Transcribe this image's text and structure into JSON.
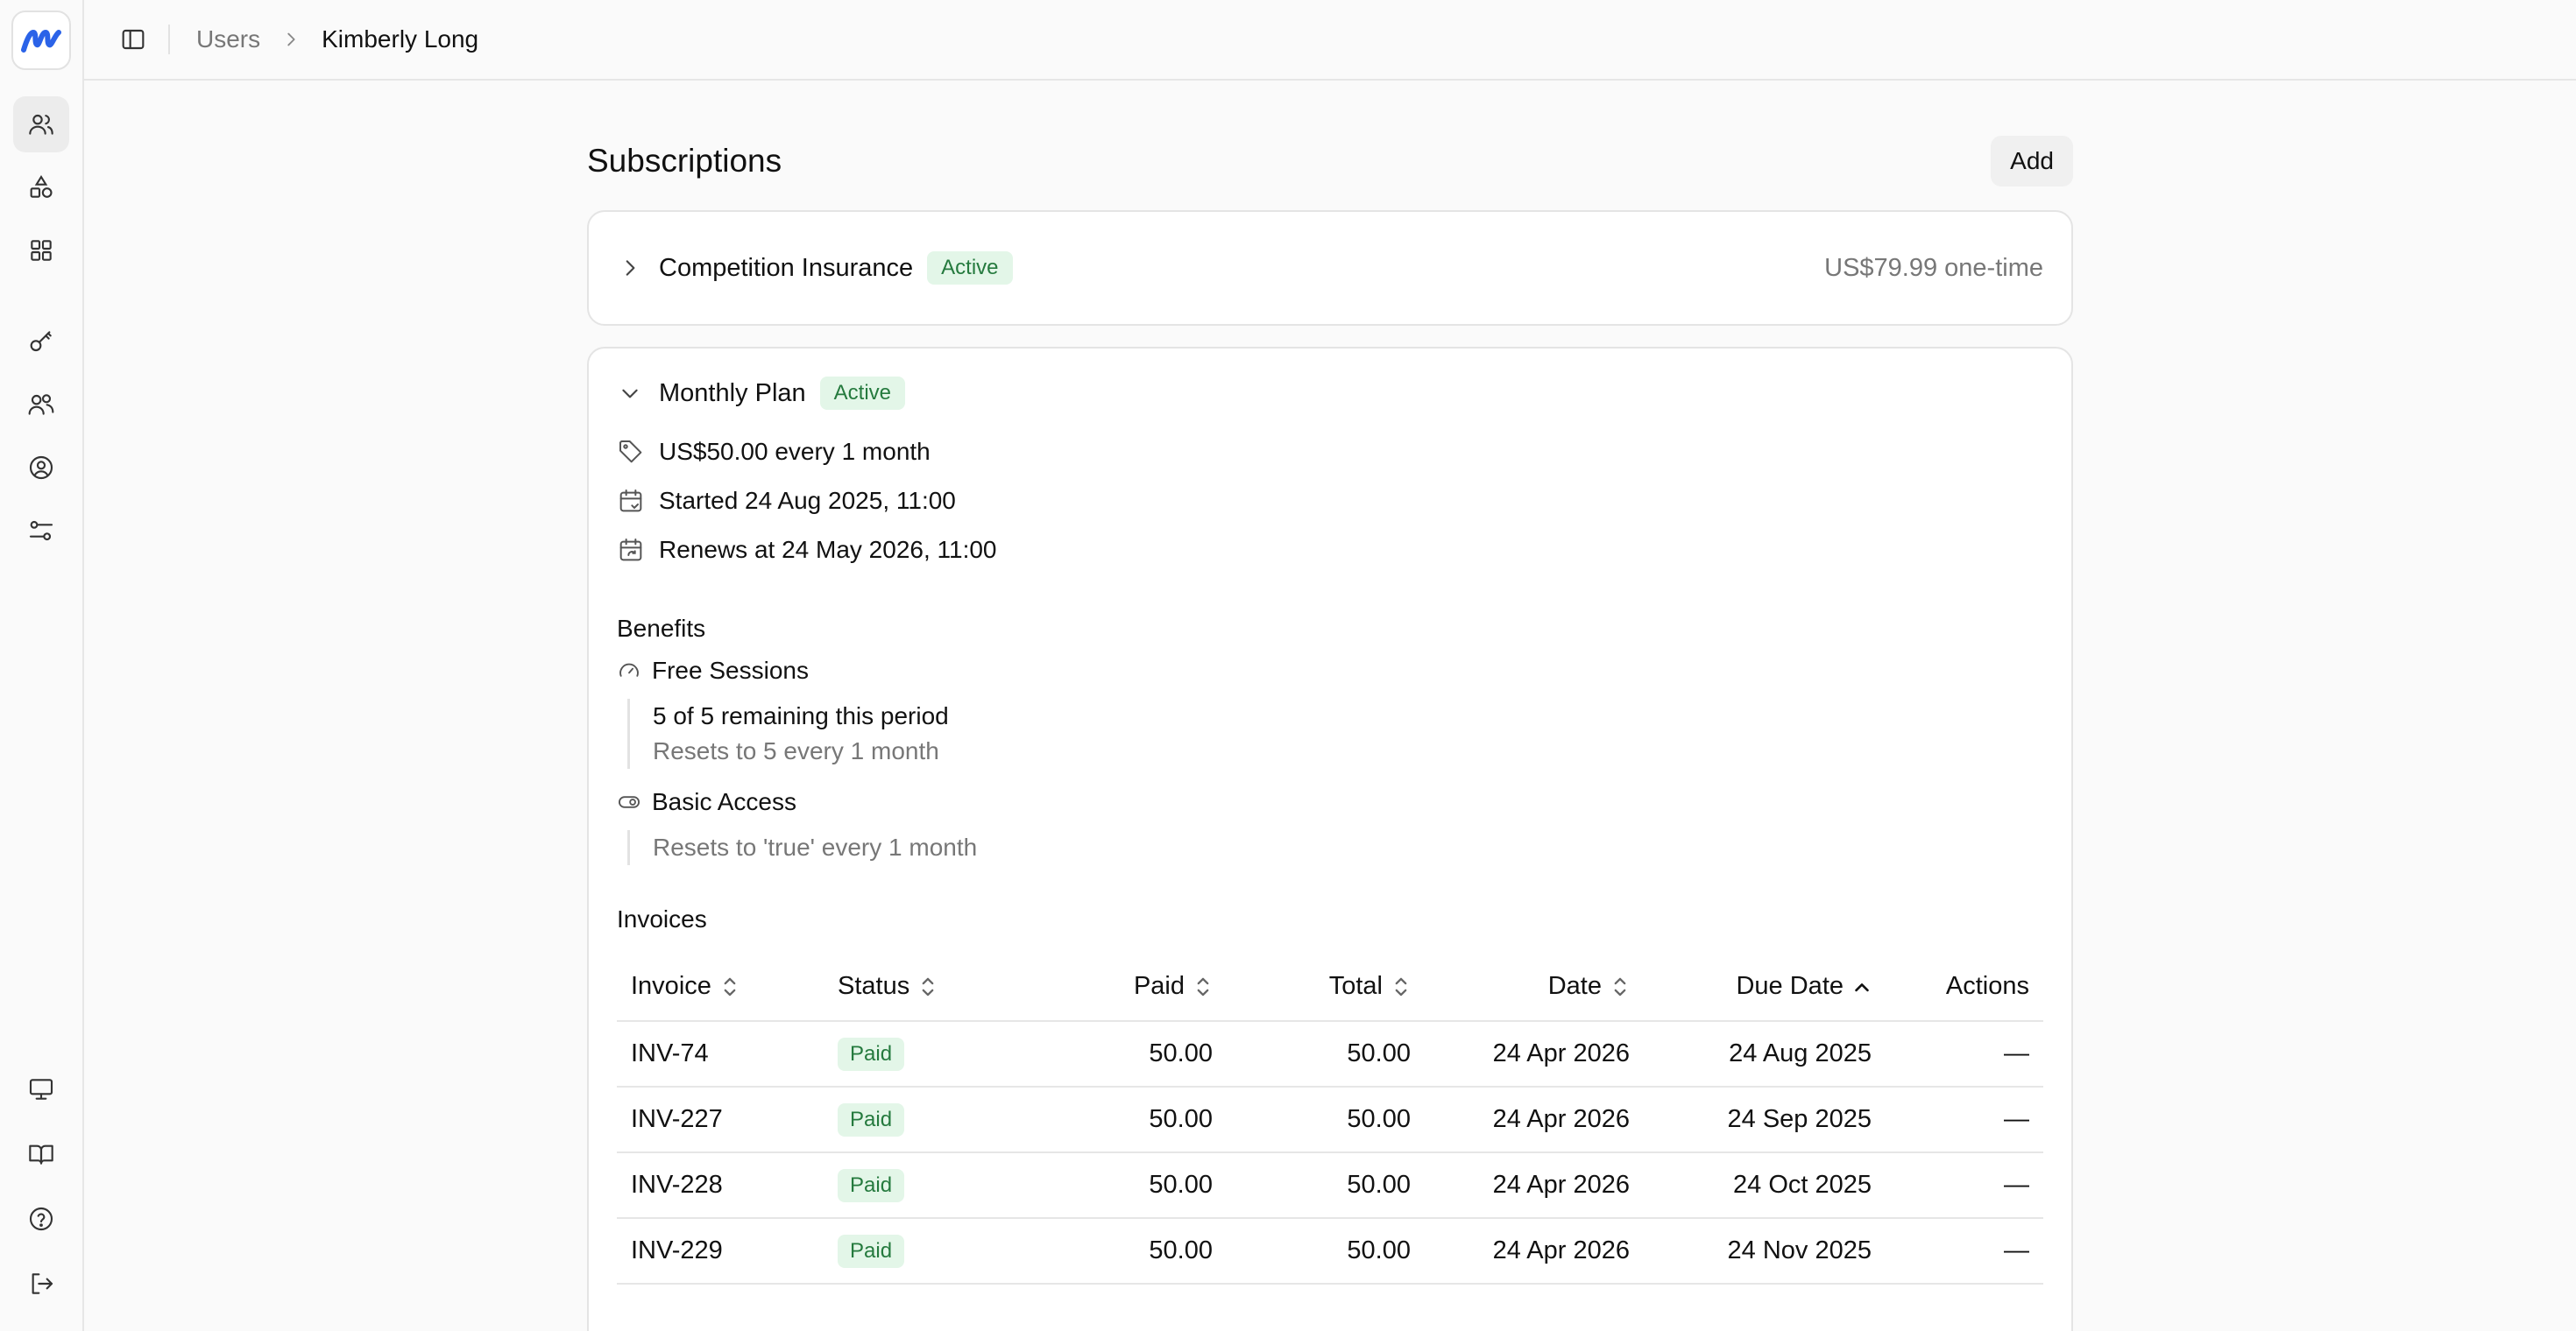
{
  "breadcrumb": {
    "parent": "Users",
    "current": "Kimberly Long"
  },
  "sidebar": {
    "top_items": [
      {
        "icon": "users-icon",
        "active": true
      },
      {
        "icon": "shapes-icon",
        "active": false
      },
      {
        "icon": "grid-icon",
        "active": false
      }
    ],
    "mid_items": [
      {
        "icon": "key-icon"
      },
      {
        "icon": "customers-icon"
      },
      {
        "icon": "user-circle-icon"
      },
      {
        "icon": "settings-sliders-icon"
      }
    ],
    "bottom_items": [
      {
        "icon": "monitor-icon"
      },
      {
        "icon": "book-icon"
      },
      {
        "icon": "help-icon"
      },
      {
        "icon": "logout-icon"
      }
    ]
  },
  "subscriptions": {
    "title": "Subscriptions",
    "add_label": "Add",
    "items": [
      {
        "name": "Competition Insurance",
        "status": "Active",
        "price": "US$79.99 one-time"
      },
      {
        "name": "Monthly Plan",
        "status": "Active",
        "price_line": "US$50.00 every 1 month",
        "started": "Started 24 Aug 2025, 11:00",
        "renews": "Renews at 24 May 2026, 11:00"
      }
    ]
  },
  "benefits": {
    "label": "Benefits",
    "items": [
      {
        "name": "Free Sessions",
        "lines": [
          "5 of 5 remaining this period",
          "Resets to 5 every 1 month"
        ]
      },
      {
        "name": "Basic Access",
        "lines": [
          "Resets to 'true' every 1 month"
        ]
      }
    ]
  },
  "invoices": {
    "label": "Invoices",
    "columns": [
      "Invoice",
      "Status",
      "Paid",
      "Total",
      "Date",
      "Due Date",
      "Actions"
    ],
    "rows": [
      {
        "invoice": "INV-74",
        "status": "Paid",
        "paid": "50.00",
        "total": "50.00",
        "date": "24 Apr 2026",
        "due": "24 Aug 2025",
        "actions": "—"
      },
      {
        "invoice": "INV-227",
        "status": "Paid",
        "paid": "50.00",
        "total": "50.00",
        "date": "24 Apr 2026",
        "due": "24 Sep 2025",
        "actions": "—"
      },
      {
        "invoice": "INV-228",
        "status": "Paid",
        "paid": "50.00",
        "total": "50.00",
        "date": "24 Apr 2026",
        "due": "24 Oct 2025",
        "actions": "—"
      },
      {
        "invoice": "INV-229",
        "status": "Paid",
        "paid": "50.00",
        "total": "50.00",
        "date": "24 Apr 2026",
        "due": "24 Nov 2025",
        "actions": "—"
      }
    ]
  },
  "colors": {
    "accent": "#2b63e8",
    "badge_bg": "#e3f6e8",
    "badge_text": "#257a3e"
  }
}
